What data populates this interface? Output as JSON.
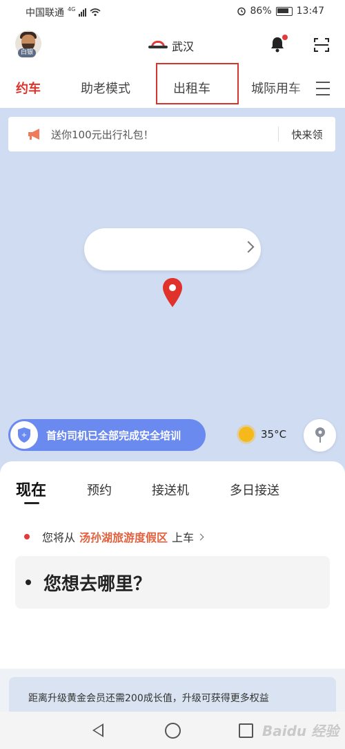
{
  "status_bar": {
    "carrier": "中国联通",
    "network": "4G",
    "battery": "86%",
    "time": "13:47"
  },
  "header": {
    "avatar_badge": "白银",
    "city": "武汉"
  },
  "tabs": [
    {
      "label": "约车",
      "active": true
    },
    {
      "label": "助老模式",
      "active": false
    },
    {
      "label": "出租车",
      "active": false
    },
    {
      "label": "城际用车",
      "active": false
    }
  ],
  "promo": {
    "text": "送你100元出行礼包！",
    "button": "快来领"
  },
  "map": {
    "safety_text": "首约司机已全部完成安全培训",
    "temperature": "35°C"
  },
  "service_tabs": [
    {
      "label": "现在",
      "active": true
    },
    {
      "label": "预约",
      "active": false
    },
    {
      "label": "接送机",
      "active": false
    },
    {
      "label": "多日接送",
      "active": false
    }
  ],
  "pickup": {
    "prefix": "您将从",
    "place": "汤孙湖旅游度假区",
    "suffix": "上车"
  },
  "destination": {
    "placeholder": "您想去哪里？"
  },
  "member": {
    "text": "距离升级黄金会员还需200成长值，升级可获得更多权益"
  },
  "watermark": "Baidu 经验",
  "colors": {
    "accent_red": "#d8342b",
    "map_bg": "#cfdcf2",
    "safety_blue": "#6b8af0"
  }
}
